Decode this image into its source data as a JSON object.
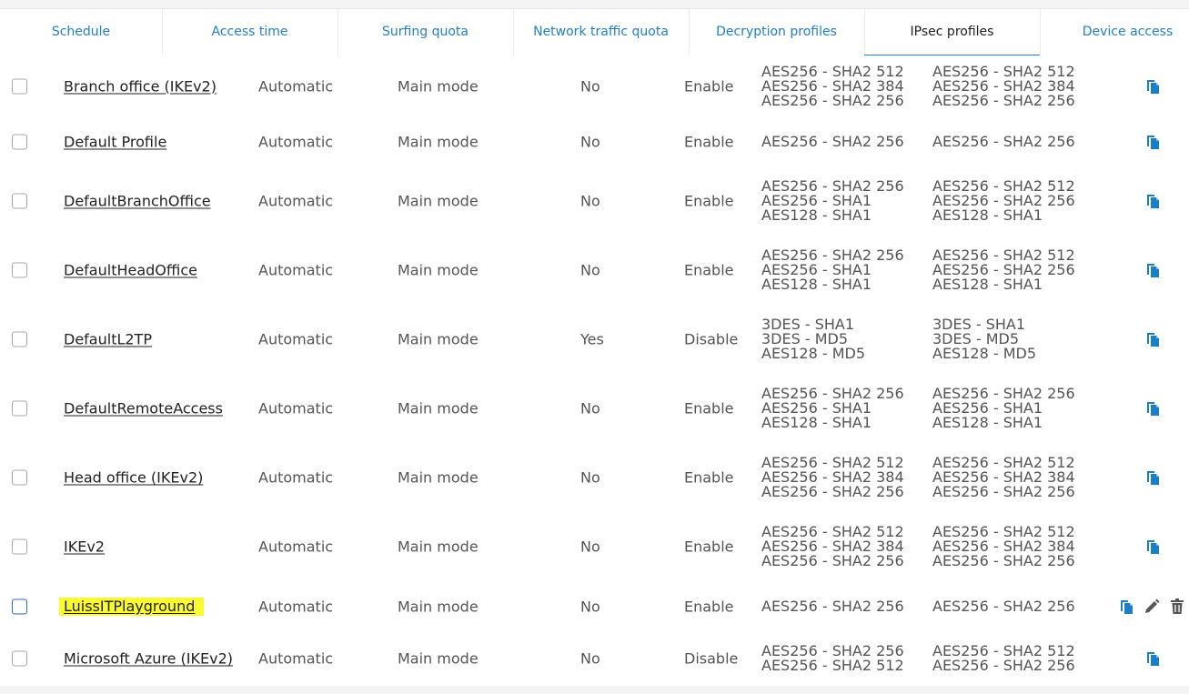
{
  "tabs": [
    {
      "label": "Schedule",
      "active": false
    },
    {
      "label": "Access time",
      "active": false
    },
    {
      "label": "Surfing quota",
      "active": false
    },
    {
      "label": "Network traffic quota",
      "active": false
    },
    {
      "label": "Decryption profiles",
      "active": false
    },
    {
      "label": "IPsec profiles",
      "active": true
    },
    {
      "label": "Device access",
      "active": false
    }
  ],
  "colors": {
    "link": "#2380c8",
    "highlight": "#fbfb2f",
    "icon_blue": "#1a7ec9",
    "icon_gray": "#555555"
  },
  "rows": [
    {
      "name": "Branch office (IKEv2)",
      "connection_mode": "Automatic",
      "exchange_mode": "Main mode",
      "pfs": "No",
      "state": "Enable",
      "phase1": [
        "AES256 - SHA2 512",
        "AES256 - SHA2 384",
        "AES256 - SHA2 256"
      ],
      "phase2": [
        "AES256 - SHA2 512",
        "AES256 - SHA2 384",
        "AES256 - SHA2 256"
      ],
      "actions": [
        "clone-icon"
      ],
      "highlighted": false
    },
    {
      "name": "Default Profile",
      "connection_mode": "Automatic",
      "exchange_mode": "Main mode",
      "pfs": "No",
      "state": "Enable",
      "phase1": [
        "AES256 - SHA2 256"
      ],
      "phase2": [
        "AES256 - SHA2 256"
      ],
      "actions": [
        "clone-icon"
      ],
      "highlighted": false
    },
    {
      "name": "DefaultBranchOffice",
      "connection_mode": "Automatic",
      "exchange_mode": "Main mode",
      "pfs": "No",
      "state": "Enable",
      "phase1": [
        "AES256 - SHA2 256",
        "AES256 - SHA1",
        "AES128 - SHA1"
      ],
      "phase2": [
        "AES256 - SHA2 512",
        "AES256 - SHA2 256",
        "AES128 - SHA1"
      ],
      "actions": [
        "clone-icon"
      ],
      "highlighted": false
    },
    {
      "name": "DefaultHeadOffice",
      "connection_mode": "Automatic",
      "exchange_mode": "Main mode",
      "pfs": "No",
      "state": "Enable",
      "phase1": [
        "AES256 - SHA2 256",
        "AES256 - SHA1",
        "AES128 - SHA1"
      ],
      "phase2": [
        "AES256 - SHA2 512",
        "AES256 - SHA2 256",
        "AES128 - SHA1"
      ],
      "actions": [
        "clone-icon"
      ],
      "highlighted": false
    },
    {
      "name": "DefaultL2TP",
      "connection_mode": "Automatic",
      "exchange_mode": "Main mode",
      "pfs": "Yes",
      "state": "Disable",
      "phase1": [
        "3DES - SHA1",
        "3DES - MD5",
        "AES128 - MD5"
      ],
      "phase2": [
        "3DES - SHA1",
        "3DES - MD5",
        "AES128 - MD5"
      ],
      "actions": [
        "clone-icon"
      ],
      "highlighted": false
    },
    {
      "name": "DefaultRemoteAccess",
      "connection_mode": "Automatic",
      "exchange_mode": "Main mode",
      "pfs": "No",
      "state": "Enable",
      "phase1": [
        "AES256 - SHA2 256",
        "AES256 - SHA1",
        "AES128 - SHA1"
      ],
      "phase2": [
        "AES256 - SHA2 256",
        "AES256 - SHA1",
        "AES128 - SHA1"
      ],
      "actions": [
        "clone-icon"
      ],
      "highlighted": false
    },
    {
      "name": "Head office (IKEv2)",
      "connection_mode": "Automatic",
      "exchange_mode": "Main mode",
      "pfs": "No",
      "state": "Enable",
      "phase1": [
        "AES256 - SHA2 512",
        "AES256 - SHA2 384",
        "AES256 - SHA2 256"
      ],
      "phase2": [
        "AES256 - SHA2 512",
        "AES256 - SHA2 384",
        "AES256 - SHA2 256"
      ],
      "actions": [
        "clone-icon"
      ],
      "highlighted": false
    },
    {
      "name": "IKEv2",
      "connection_mode": "Automatic",
      "exchange_mode": "Main mode",
      "pfs": "No",
      "state": "Enable",
      "phase1": [
        "AES256 - SHA2 512",
        "AES256 - SHA2 384",
        "AES256 - SHA2 256"
      ],
      "phase2": [
        "AES256 - SHA2 512",
        "AES256 - SHA2 384",
        "AES256 - SHA2 256"
      ],
      "actions": [
        "clone-icon"
      ],
      "highlighted": false
    },
    {
      "name": "LuissITPlayground",
      "connection_mode": "Automatic",
      "exchange_mode": "Main mode",
      "pfs": "No",
      "state": "Enable",
      "phase1": [
        "AES256 - SHA2 256"
      ],
      "phase2": [
        "AES256 - SHA2 256"
      ],
      "actions": [
        "clone-icon",
        "edit-icon",
        "delete-icon"
      ],
      "highlighted": true
    },
    {
      "name": "Microsoft Azure (IKEv2)",
      "connection_mode": "Automatic",
      "exchange_mode": "Main mode",
      "pfs": "No",
      "state": "Disable",
      "phase1": [
        "AES256 - SHA2 256",
        "AES256 - SHA2 512"
      ],
      "phase2": [
        "AES256 - SHA2 512",
        "AES256 - SHA2 256"
      ],
      "actions": [
        "clone-icon"
      ],
      "highlighted": false
    }
  ]
}
